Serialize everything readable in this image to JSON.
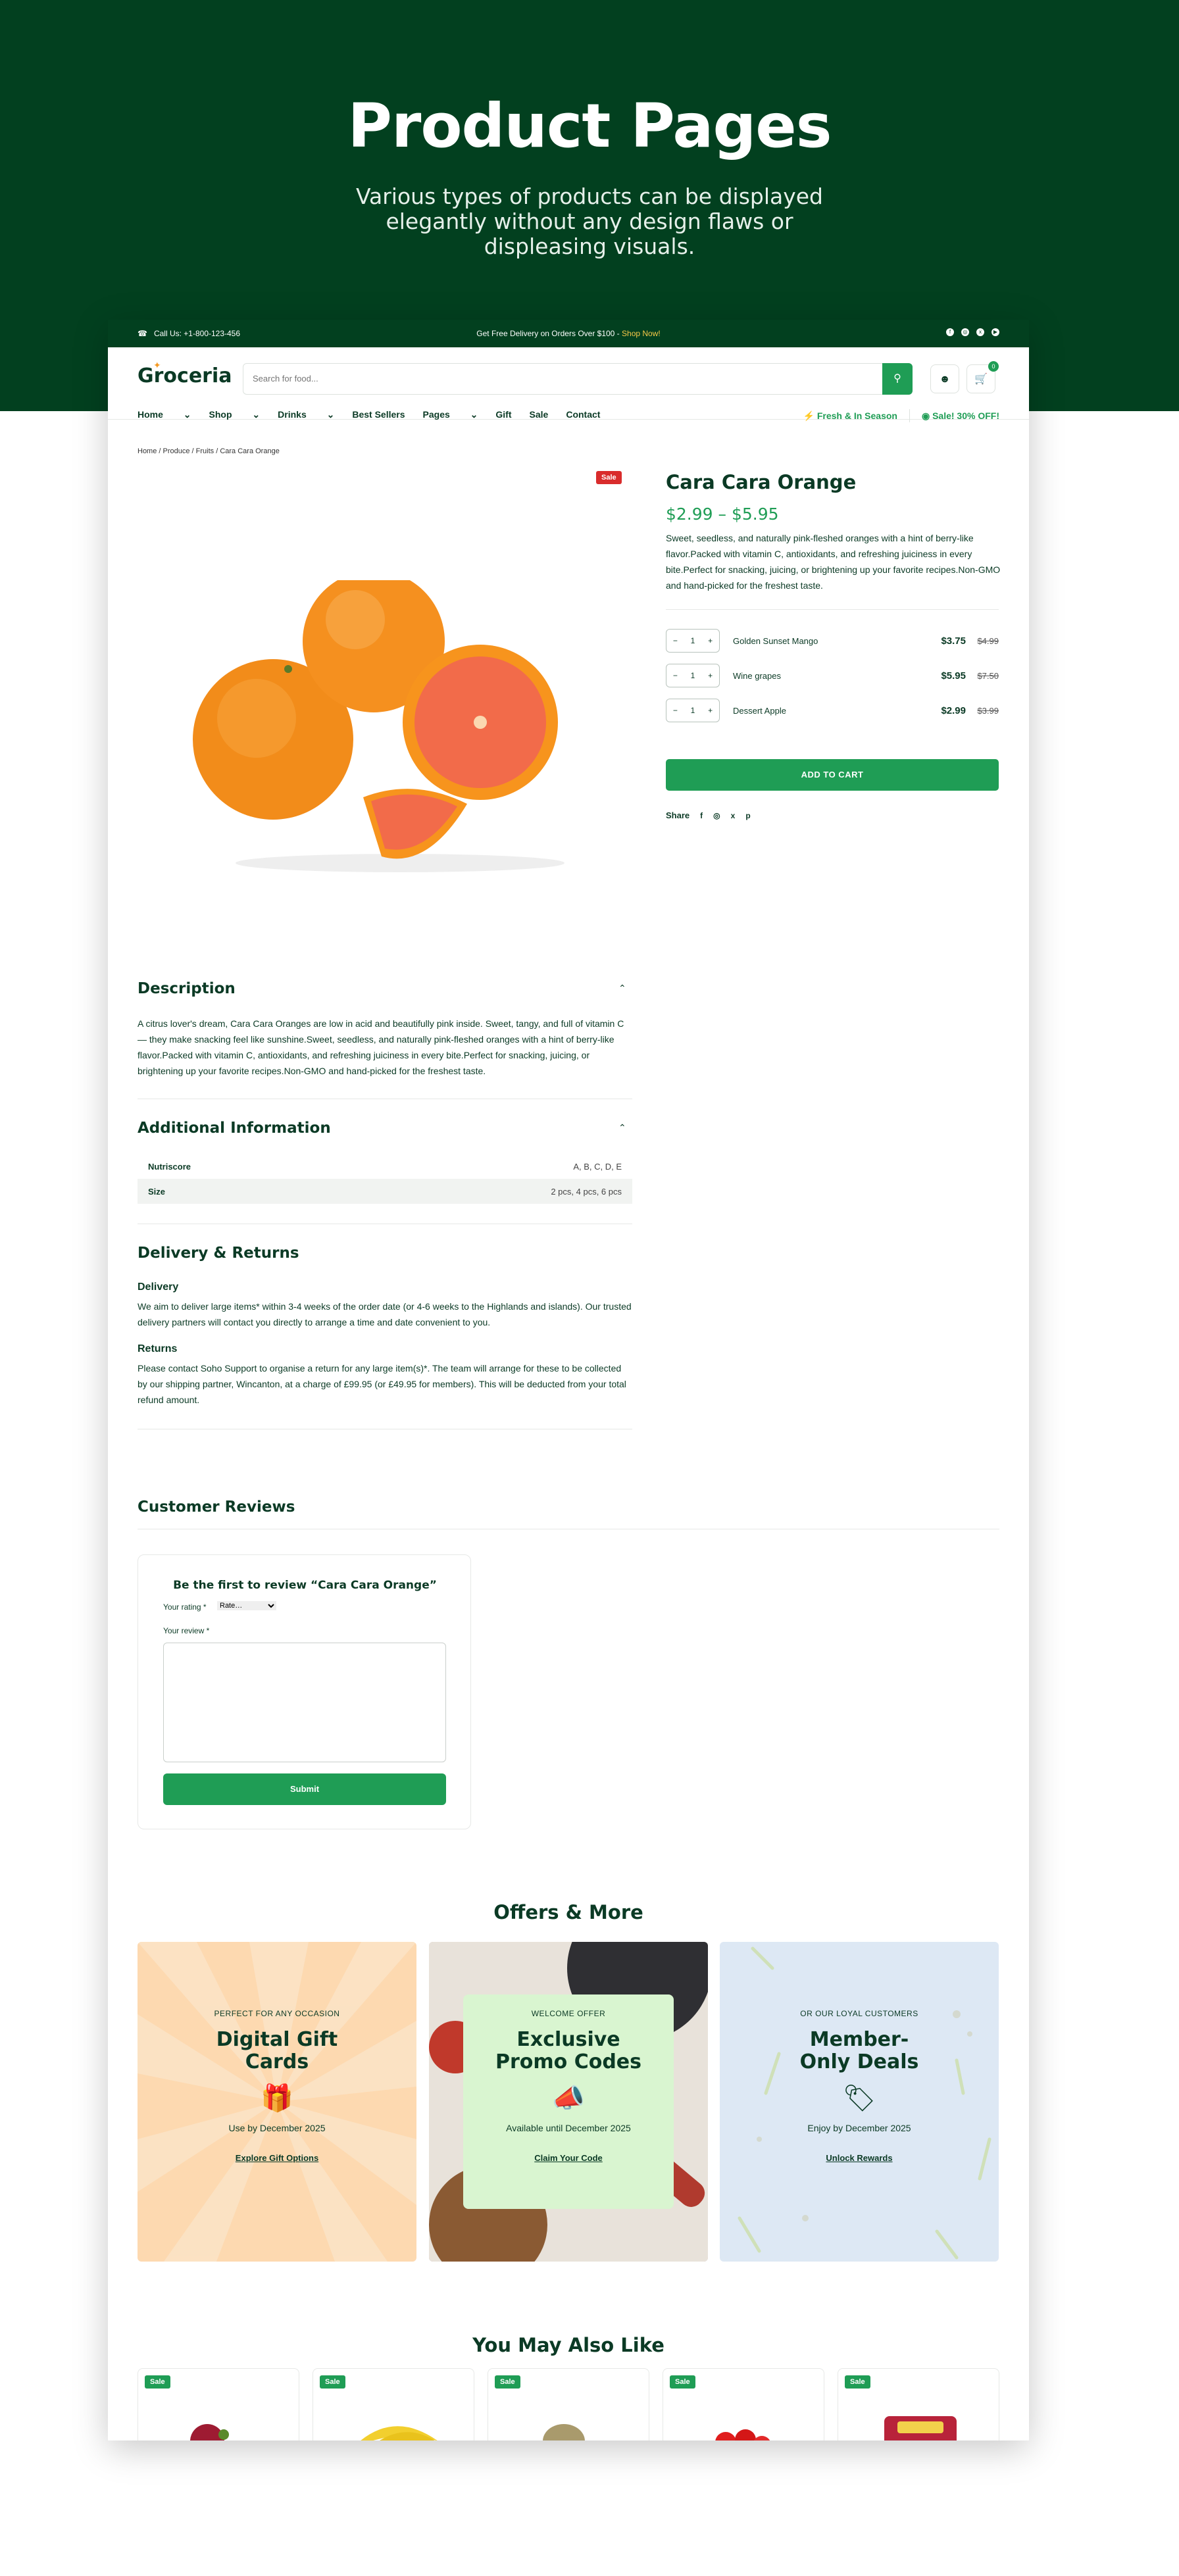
{
  "hero": {
    "title": "Product Pages",
    "subtitle": "Various types of products can be displayed elegantly without any design flaws or displeasing visuals."
  },
  "topbar": {
    "call": "Call Us: +1-800-123-456",
    "promo": "Get Free Delivery on Orders Over $100 - ",
    "promo_link": "Shop Now!",
    "social_icons": [
      "facebook-icon",
      "instagram-icon",
      "x-icon",
      "youtube-icon"
    ]
  },
  "header": {
    "logo": "Groceria",
    "search_placeholder": "Search for food...",
    "cart_count": "0"
  },
  "nav": {
    "items": [
      "Home",
      "Shop",
      "Drinks",
      "Best Sellers",
      "Pages",
      "Gift",
      "Sale",
      "Contact"
    ],
    "fresh": "Fresh & In Season",
    "sale": "Sale! 30% OFF!"
  },
  "breadcrumb": "Home / Produce / Fruits / Cara Cara Orange",
  "product": {
    "sale_badge": "Sale",
    "title": "Cara Cara Orange",
    "price": "$2.99  –  $5.95",
    "description": "Sweet, seedless, and naturally pink-fleshed oranges with a hint of berry-like flavor.Packed with vitamin C, antioxidants, and refreshing juiciness in every bite.Perfect for snacking, juicing, or brightening up your favorite recipes.Non-GMO and hand-picked for the freshest taste.",
    "variants": [
      {
        "qty": "1",
        "name": "Golden Sunset Mango",
        "price": "$3.75",
        "old": "$4.99"
      },
      {
        "qty": "1",
        "name": "Wine grapes",
        "price": "$5.95",
        "old": "$7.50"
      },
      {
        "qty": "1",
        "name": "Dessert Apple",
        "price": "$2.99",
        "old": "$3.99"
      }
    ],
    "add_to_cart": "ADD TO CART",
    "share": "Share"
  },
  "description": {
    "heading": "Description",
    "text": "A citrus lover's dream, Cara Cara Oranges are low in acid and beautifully pink inside. Sweet, tangy, and full of vitamin C — they make snacking feel like sunshine.Sweet, seedless, and naturally pink-fleshed oranges with a hint of berry-like flavor.Packed with vitamin C, antioxidants, and refreshing juiciness in every bite.Perfect for snacking, juicing, or brightening up your favorite recipes.Non-GMO and hand-picked for the freshest taste."
  },
  "additional": {
    "heading": "Additional Information",
    "rows": [
      {
        "key": "Nutriscore",
        "value": "A, B, C, D, E"
      },
      {
        "key": "Size",
        "value": "2 pcs, 4 pcs, 6 pcs"
      }
    ]
  },
  "delivery": {
    "heading": "Delivery & Returns",
    "delivery_title": "Delivery",
    "delivery_text": "We aim to deliver large items* within 3-4 weeks of the order date (or 4-6 weeks to the Highlands and islands). Our trusted delivery partners will contact you directly to arrange a time and date convenient to you.",
    "returns_title": "Returns",
    "returns_text": "Please contact Soho Support to organise a return for any large item(s)*. The team will arrange for these to be collected by our shipping partner, Wincanton, at a charge of £99.95 (or £49.95 for members). This will be deducted from your total refund amount."
  },
  "reviews": {
    "heading": "Customer Reviews",
    "form_title": "Be the first to review “Cara Cara Orange”",
    "rating_label": "Your rating *",
    "rating_value": "Rate…",
    "review_label": "Your review *",
    "submit": "Submit"
  },
  "offers": {
    "heading": "Offers & More",
    "cards": [
      {
        "kicker": "PERFECT FOR ANY OCCASION",
        "title": "Digital Gift Cards",
        "icon": "gift-icon",
        "date": "Use by December 2025",
        "link": "Explore Gift Options"
      },
      {
        "kicker": "WELCOME OFFER",
        "title": "Exclusive Promo Codes",
        "icon": "megaphone-icon",
        "date": "Available until December 2025",
        "link": "Claim Your Code"
      },
      {
        "kicker": "OR OUR LOYAL CUSTOMERS",
        "title": "Member-Only Deals",
        "icon": "tag-icon",
        "date": "Enjoy by December 2025",
        "link": "Unlock Rewards"
      }
    ],
    "colors": {
      "gift": "#fdd9b0",
      "promo": "#d9f5d0",
      "member": "#dde8f4"
    }
  },
  "related": {
    "heading": "You May Also Like",
    "badges": [
      "Sale",
      "Sale",
      "Sale",
      "Sale",
      "Sale"
    ]
  },
  "colors": {
    "brand_dark": "#02401f",
    "accent": "#1f9d55",
    "sale": "#d92c2c"
  }
}
